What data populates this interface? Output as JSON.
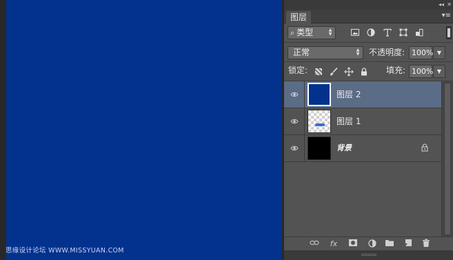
{
  "canvas": {
    "color": "#02328e",
    "watermark": "思缘设计论坛 WWW.MISSYUAN.COM"
  },
  "panel": {
    "collapse_glyph": "◂◂",
    "close_glyph": "✕",
    "tab_label": "图层",
    "menu_glyph": "▾≡",
    "filter": {
      "select_icon": "⌕",
      "select_label": "类型",
      "icons": [
        "image-filter-icon",
        "adjustment-filter-icon",
        "type-filter-icon",
        "shape-filter-icon",
        "smart-object-filter-icon"
      ]
    },
    "blend": {
      "mode": "正常",
      "opacity_label": "不透明度:",
      "opacity_value": "100%"
    },
    "lock": {
      "label": "锁定:",
      "fill_label": "填充:",
      "fill_value": "100%"
    },
    "layers": [
      {
        "name": "图层 2",
        "selected": true,
        "thumb": "blue"
      },
      {
        "name": "图层 1",
        "selected": false,
        "thumb": "checker"
      },
      {
        "name": "背景",
        "selected": false,
        "thumb": "black",
        "locked": true
      }
    ],
    "bottom_icons": [
      "link-icon",
      "fx-icon",
      "mask-icon",
      "adjustment-icon",
      "folder-icon",
      "new-layer-icon",
      "trash-icon"
    ],
    "fx_text": "fx"
  }
}
